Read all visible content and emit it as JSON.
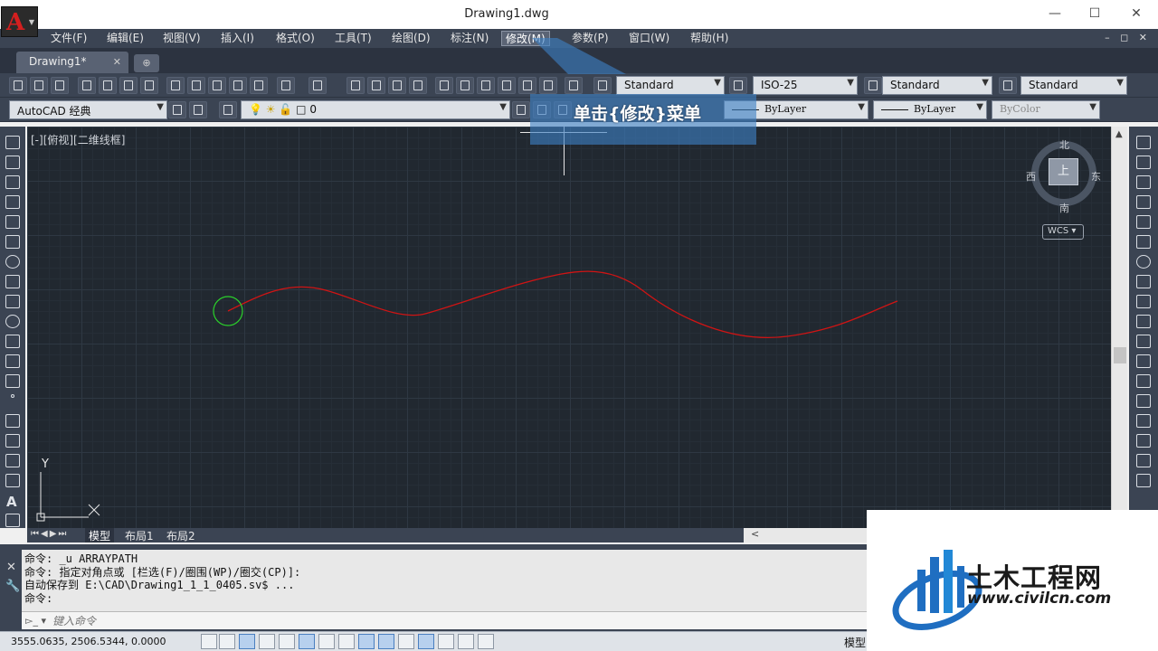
{
  "window": {
    "title": "Drawing1.dwg",
    "minimize": "—",
    "maximize": "☐",
    "close": "✕"
  },
  "menu": [
    "文件(F)",
    "编辑(E)",
    "视图(V)",
    "插入(I)",
    "格式(O)",
    "工具(T)",
    "绘图(D)",
    "标注(N)",
    "修改(M)",
    "参数(P)",
    "窗口(W)",
    "帮助(H)"
  ],
  "menu_active": "修改(M)",
  "menu_right": "– ◻ ✕",
  "tabs": {
    "doc": "Drawing1*",
    "close": "✕",
    "new": "⊕"
  },
  "toolbar1": {
    "text_style": "Standard",
    "dim_style": "ISO-25",
    "table_style": "Standard",
    "multileader_style": "Standard"
  },
  "toolbar2": {
    "workspace": "AutoCAD 经典",
    "layer": "0",
    "color": "",
    "linetype": "ByLayer",
    "lineweight": "ByLayer",
    "plotstyle": "ByColor"
  },
  "canvas": {
    "viewport_label": "[-][俯视][二维线框]",
    "ucs_y": "Y",
    "ucs_x": "X"
  },
  "viewcube": {
    "north": "北",
    "south": "南",
    "east": "东",
    "west": "西",
    "face": "上",
    "wcs": "WCS ▾"
  },
  "layout_tabs": {
    "nav": "⏮◀▶⏭",
    "tabs": [
      "模型",
      "布局1",
      "布局2"
    ],
    "active": "模型"
  },
  "command": {
    "lines": [
      "命令: _u ARRAYPATH",
      "命令: 指定对角点或 [栏选(F)/圈围(WP)/圈交(CP)]:",
      "自动保存到 E:\\CAD\\Drawing1_1_1_0405.sv$ ...",
      "命令:"
    ],
    "placeholder": "键入命令",
    "prompt": "▻_ ▾"
  },
  "status": {
    "coords": "3555.0635, 2506.5344, 0.0000",
    "model": "模型"
  },
  "callout": {
    "text": "单击{修改}菜单"
  },
  "watermark": {
    "name": "土木工程网",
    "url": "www.civilcn.com"
  },
  "colors": {
    "spline": "#d01414",
    "circle": "#2bd12b",
    "canvas": "#212830"
  }
}
